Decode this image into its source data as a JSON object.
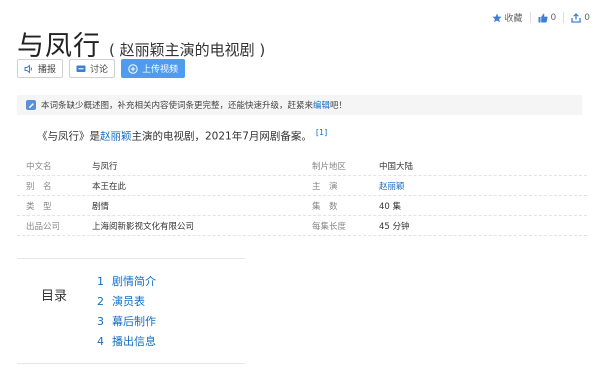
{
  "top_tools": {
    "favorite_label": "收藏",
    "like_count": "0",
    "share_count": "0"
  },
  "title": {
    "main": "与凤行",
    "sub": "( 赵丽颖主演的电视剧 )"
  },
  "actions": {
    "report_label": "播报",
    "discuss_label": "讨论",
    "upload_label": "上传视频"
  },
  "notice": {
    "text": "本词条缺少概述图，补充相关内容使词条更完整，还能快速升级，赶紧来",
    "link": "编辑",
    "suffix": "吧！"
  },
  "summary": {
    "part1": "《与凤行》是",
    "link": "赵丽颖",
    "part2": "主演的电视剧，2021年7月网剧备案。",
    "ref": "[1]"
  },
  "info": [
    {
      "label1": "中文名",
      "value1": "与凤行",
      "label2": "制片地区",
      "value2": "中国大陆"
    },
    {
      "label1": "别　名",
      "value1": "本王在此",
      "label2": "主　演",
      "value2": "赵丽颖"
    },
    {
      "label1": "类　型",
      "value1": "剧情",
      "label2": "集　数",
      "value2": "40 集"
    },
    {
      "label1": "出品公司",
      "value1": "上海阅新影视文化有限公司",
      "label2": "每集长度",
      "value2": "45 分钟"
    }
  ],
  "catalog": {
    "title": "目录",
    "items": [
      {
        "num": "1",
        "label": "剧情简介"
      },
      {
        "num": "2",
        "label": "演员表"
      },
      {
        "num": "3",
        "label": "幕后制作"
      },
      {
        "num": "4",
        "label": "播出信息"
      }
    ]
  },
  "colors": {
    "link": "#136ec2",
    "accent_button": "#4f9cee",
    "notice_bg": "#f5f5f5"
  }
}
